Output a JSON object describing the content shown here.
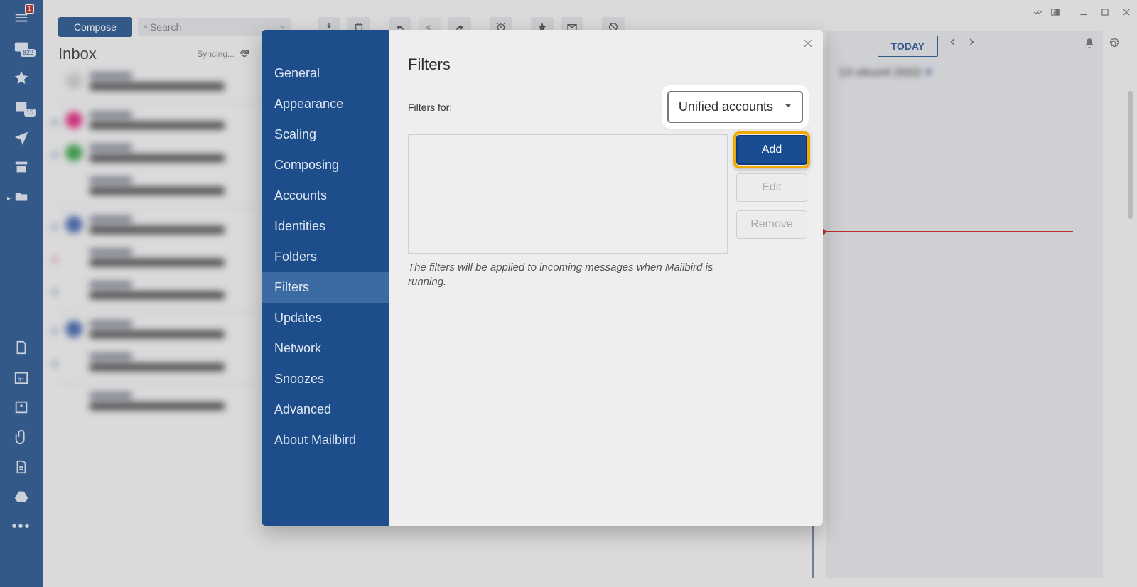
{
  "rail": {
    "menu_badge": "1",
    "inbox_count": "822",
    "drafts_count": "15",
    "calendar_day": "31"
  },
  "toolbar": {
    "compose_label": "Compose",
    "search_placeholder": "Search"
  },
  "inbox": {
    "title": "Inbox",
    "sync_status": "Syncing..."
  },
  "right_pane": {
    "today_label": "TODAY",
    "date_blur": "13 okunii 2022"
  },
  "settings_modal": {
    "title": "Filters",
    "sidebar": [
      {
        "label": "General"
      },
      {
        "label": "Appearance"
      },
      {
        "label": "Scaling"
      },
      {
        "label": "Composing"
      },
      {
        "label": "Accounts"
      },
      {
        "label": "Identities"
      },
      {
        "label": "Folders"
      },
      {
        "label": "Filters",
        "active": true
      },
      {
        "label": "Updates"
      },
      {
        "label": "Network"
      },
      {
        "label": "Snoozes"
      },
      {
        "label": "Advanced"
      },
      {
        "label": "About Mailbird"
      }
    ],
    "filters_for_label": "Filters for:",
    "account_selected": "Unified accounts",
    "note": "The filters will be applied to incoming messages when Mailbird is running.",
    "actions": {
      "add": "Add",
      "edit": "Edit",
      "remove": "Remove"
    }
  }
}
